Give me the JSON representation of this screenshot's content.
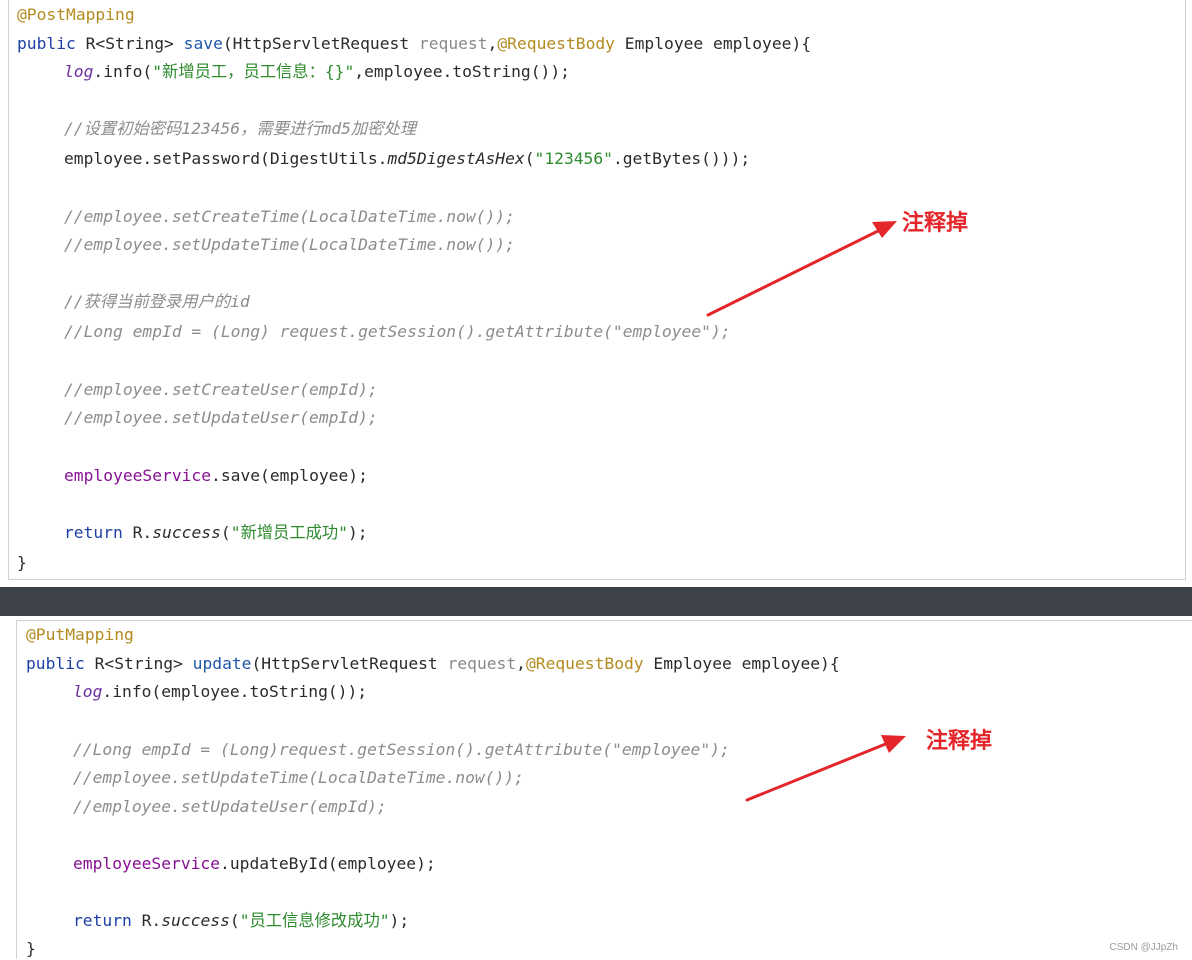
{
  "top": {
    "annotation": "@PostMapping",
    "sig_public": "public",
    "sig_return": " R<String> ",
    "sig_method": "save",
    "sig_open": "(HttpServletRequest ",
    "sig_param1": "request",
    "sig_comma": ",",
    "sig_annotation": "@RequestBody",
    "sig_rest": " Employee employee){",
    "log_obj": "log",
    "log_call_a": ".info(",
    "log_str": "\"新增员工，员工信息：{}\"",
    "log_call_b": ",employee.toString());",
    "comment_pwd": "//设置初始密码123456，需要进行md5加密处理",
    "pwd_a": "employee.setPassword(DigestUtils.",
    "pwd_md5": "md5DigestAsHex",
    "pwd_b": "(",
    "pwd_str": "\"123456\"",
    "pwd_c": ".getBytes()));",
    "comment_create_time": "//employee.setCreateTime(LocalDateTime.now());",
    "comment_update_time": "//employee.setUpdateTime(LocalDateTime.now());",
    "comment_get_id": "//获得当前登录用户的id",
    "comment_empid": "//Long empId = (Long) request.getSession().getAttribute(\"employee\");",
    "comment_create_user": "//employee.setCreateUser(empId);",
    "comment_update_user": "//employee.setUpdateUser(empId);",
    "service_field": "employeeService",
    "service_call": ".save(employee);",
    "ret_kw": "return",
    "ret_a": " R.",
    "ret_success": "success",
    "ret_b": "(",
    "ret_str": "\"新增员工成功\"",
    "ret_c": ");",
    "close_brace": "}",
    "note": "注释掉"
  },
  "bottom": {
    "annotation": "@PutMapping",
    "sig_public": "public",
    "sig_return": " R<String> ",
    "sig_method": "update",
    "sig_open": "(HttpServletRequest ",
    "sig_param1": "request",
    "sig_comma": ",",
    "sig_annotation": "@RequestBody",
    "sig_rest": " Employee employee){",
    "log_obj": "log",
    "log_call": ".info(employee.toString());",
    "comment_empid": "//Long empId = (Long)request.getSession().getAttribute(\"employee\");",
    "comment_update_time": "//employee.setUpdateTime(LocalDateTime.now());",
    "comment_update_user": "//employee.setUpdateUser(empId);",
    "service_field": "employeeService",
    "service_call": ".updateById(employee);",
    "ret_kw": "return",
    "ret_a": " R.",
    "ret_success": "success",
    "ret_b": "(",
    "ret_str": "\"员工信息修改成功\"",
    "ret_c": ");",
    "close_brace": "}",
    "note": "注释掉"
  },
  "watermark": "CSDN @JJpZh",
  "colors": {
    "annotation": "#b38b20",
    "keyword": "#1f3fa6",
    "string": "#2e8b2e",
    "comment": "#8c8c8c",
    "arrow": "#e4262a",
    "divider": "#3e4349"
  }
}
